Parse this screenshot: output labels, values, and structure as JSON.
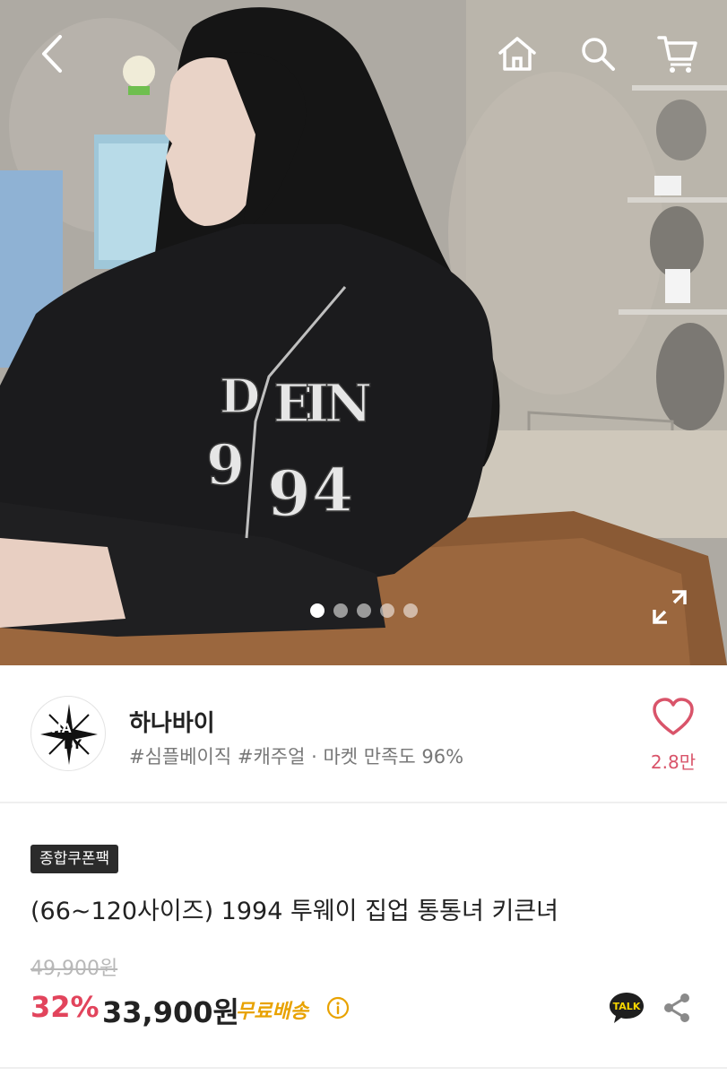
{
  "gallery": {
    "slide_count": 5,
    "active_slide": 1
  },
  "nav": {
    "icons": [
      "back-icon",
      "home-icon",
      "search-icon",
      "cart-icon"
    ]
  },
  "shop": {
    "name": "하나바이",
    "tags": "#심플베이직 #캐주얼 · 마켓 만족도 96%",
    "like_count": "2.8만",
    "logo_text": "HANABY"
  },
  "product": {
    "coupon_badge": "종합쿠폰팩",
    "title": "(66~120사이즈) 1994 투웨이 집업 통통녀 키큰녀",
    "original_price": "49,900원",
    "discount_rate": "32%",
    "sale_price": "33,900원",
    "shipping": "무료배송",
    "talk_label": "TALK"
  },
  "colors": {
    "accent_pink": "#e2445c",
    "like_pink": "#d9546a",
    "shipping_yellow": "#e8a200"
  }
}
